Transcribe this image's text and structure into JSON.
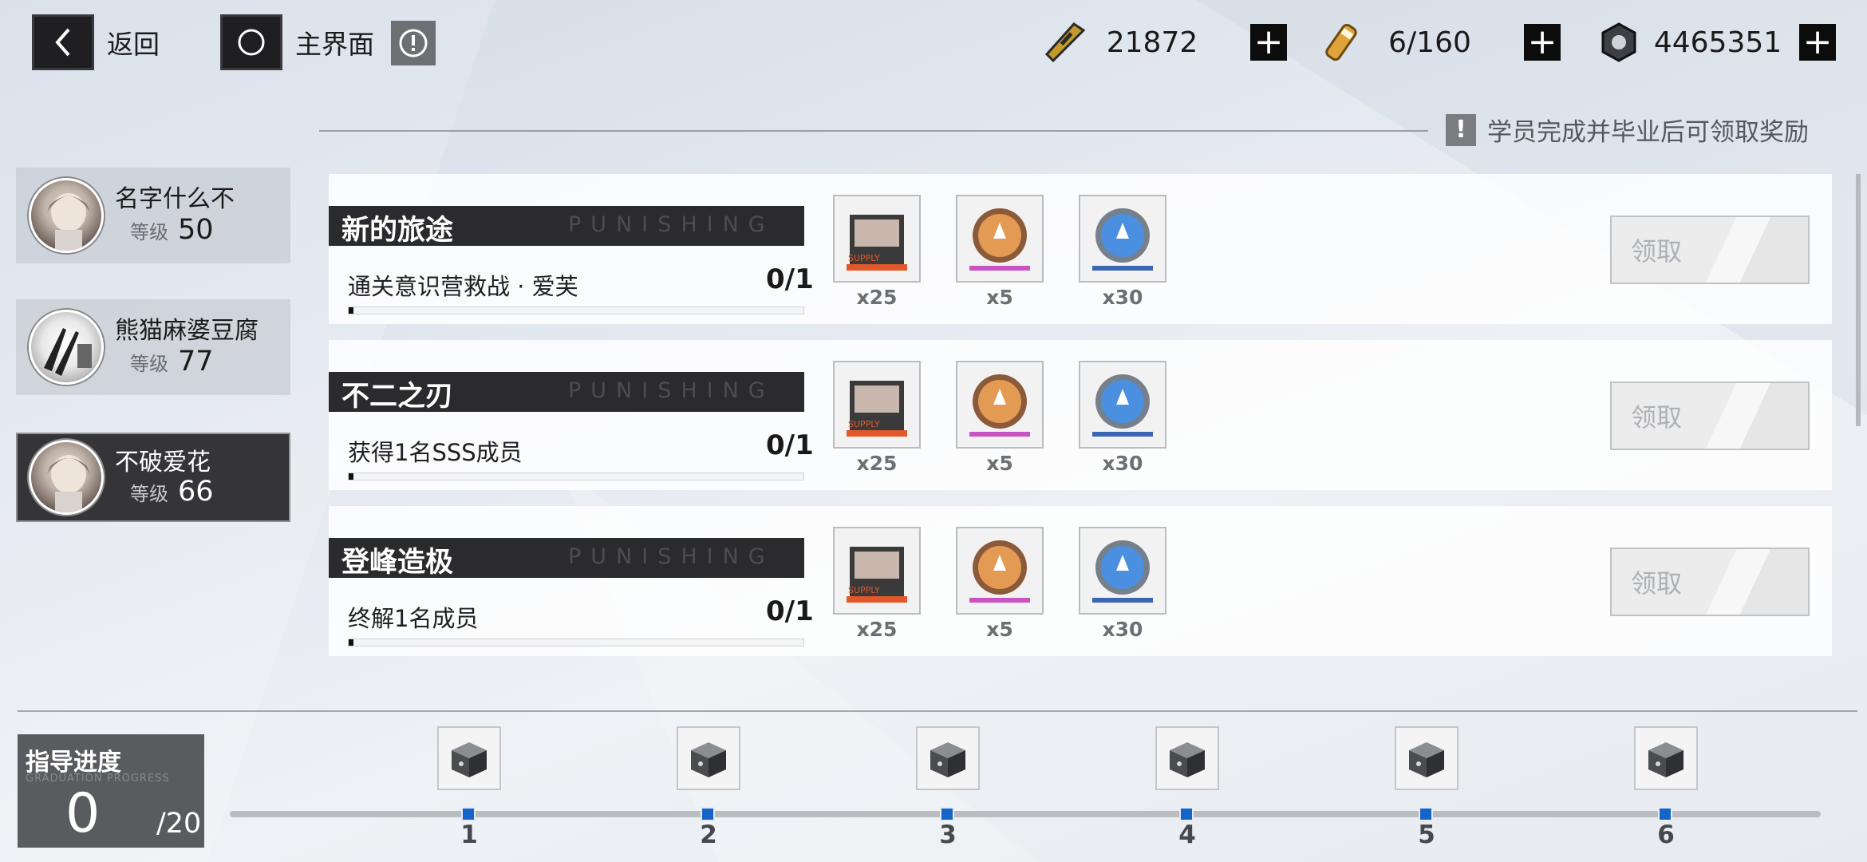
{
  "top": {
    "back_label": "返回",
    "home_label": "主界面",
    "resources": [
      {
        "icon": "stamina-card-icon",
        "value": "21872"
      },
      {
        "icon": "battery-icon",
        "value": "6/160"
      },
      {
        "icon": "coin-nut-icon",
        "value": "4465351"
      }
    ],
    "plus": "+"
  },
  "hint": {
    "icon": "!",
    "text": "学员完成并毕业后可领取奖励"
  },
  "students": [
    {
      "name": "名字什么不",
      "level_key": "等级",
      "level": "50",
      "selected": false
    },
    {
      "name": "熊猫麻婆豆腐",
      "level_key": "等级",
      "level": "77",
      "selected": false
    },
    {
      "name": "不破爱花",
      "level_key": "等级",
      "level": "66",
      "selected": true
    }
  ],
  "tasks": [
    {
      "title": "新的旅途",
      "deco": "PUNISHING",
      "desc": "通关意识营救战 · 爱芙",
      "progress": "0/1",
      "progress_value": 0,
      "rewards": [
        {
          "icon": "supply-chip-icon",
          "count": "x25"
        },
        {
          "icon": "orange-coin-icon",
          "count": "x5"
        },
        {
          "icon": "blue-coin-icon",
          "count": "x30"
        }
      ],
      "claim_label": "领取"
    },
    {
      "title": "不二之刃",
      "deco": "PUNISHING",
      "desc": "获得1名SSS成员",
      "progress": "0/1",
      "progress_value": 0,
      "rewards": [
        {
          "icon": "supply-chip-icon",
          "count": "x25"
        },
        {
          "icon": "orange-coin-icon",
          "count": "x5"
        },
        {
          "icon": "blue-coin-icon",
          "count": "x30"
        }
      ],
      "claim_label": "领取"
    },
    {
      "title": "登峰造极",
      "deco": "PUNISHING",
      "desc": "终解1名成员",
      "progress": "0/1",
      "progress_value": 0,
      "rewards": [
        {
          "icon": "supply-chip-icon",
          "count": "x25"
        },
        {
          "icon": "orange-coin-icon",
          "count": "x5"
        },
        {
          "icon": "blue-coin-icon",
          "count": "x30"
        }
      ],
      "claim_label": "领取"
    }
  ],
  "guidance": {
    "title": "指导进度",
    "subtitle": "GRADUATION PROGRESS",
    "value": "0",
    "max": "/20",
    "milestones": [
      "1",
      "2",
      "3",
      "4",
      "5",
      "6"
    ]
  },
  "colors": {
    "accent": "#1565c8",
    "dark": "#2b2b2d"
  }
}
